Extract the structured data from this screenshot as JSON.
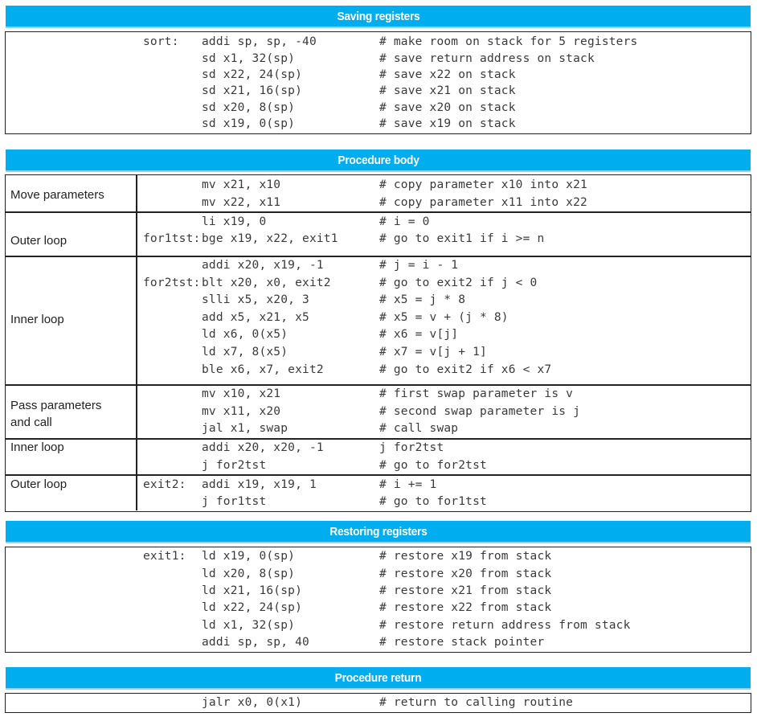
{
  "sections": {
    "saving": {
      "title": "Saving registers",
      "lines": [
        {
          "label": "sort:",
          "instr": "addi sp, sp, -40",
          "comment": "# make room on stack for 5 registers"
        },
        {
          "label": "",
          "instr": "sd x1, 32(sp)",
          "comment": "# save return address on stack"
        },
        {
          "label": "",
          "instr": "sd x22, 24(sp)",
          "comment": "# save x22 on stack"
        },
        {
          "label": "",
          "instr": "sd x21, 16(sp)",
          "comment": "# save x21 on stack"
        },
        {
          "label": "",
          "instr": "sd x20, 8(sp)",
          "comment": "# save x20 on stack"
        },
        {
          "label": "",
          "instr": "sd x19, 0(sp)",
          "comment": "# save x19 on stack"
        }
      ]
    },
    "body": {
      "title": "Procedure body",
      "groups": [
        {
          "name": "Move parameters",
          "lines": [
            {
              "label": "",
              "instr": "mv x21, x10",
              "comment": "# copy parameter x10 into x21"
            },
            {
              "label": "",
              "instr": "mv x22, x11",
              "comment": "# copy parameter x11 into x22"
            }
          ]
        },
        {
          "name": "Outer loop",
          "lines": [
            {
              "label": "",
              "instr": "li x19, 0",
              "comment": "# i = 0"
            },
            {
              "label": "for1tst:",
              "instr": "bge x19, x22, exit1",
              "comment": "# go to exit1 if i >= n"
            }
          ]
        },
        {
          "name": "Inner loop",
          "lines": [
            {
              "label": "",
              "instr": "addi x20, x19, -1",
              "comment": "# j = i - 1"
            },
            {
              "label": "for2tst:",
              "instr": "blt x20, x0, exit2",
              "comment": "# go to exit2 if j < 0"
            },
            {
              "label": "",
              "instr": "slli x5, x20, 3",
              "comment": "# x5 = j * 8"
            },
            {
              "label": "",
              "instr": "add x5, x21, x5",
              "comment": "# x5 = v + (j * 8)"
            },
            {
              "label": "",
              "instr": "ld x6, 0(x5)",
              "comment": "# x6 = v[j]"
            },
            {
              "label": "",
              "instr": "ld x7, 8(x5)",
              "comment": "# x7 = v[j + 1]"
            },
            {
              "label": "",
              "instr": "ble x6, x7, exit2",
              "comment": "# go to exit2 if x6 < x7"
            }
          ]
        },
        {
          "name": "Pass parameters and call",
          "name_line1": "Pass parameters",
          "name_line2": "and call",
          "lines": [
            {
              "label": "",
              "instr": "mv x10, x21",
              "comment": "# first swap parameter is v"
            },
            {
              "label": "",
              "instr": "mv x11, x20",
              "comment": "# second swap parameter is j"
            },
            {
              "label": "",
              "instr": "jal x1, swap",
              "comment": "# call swap"
            }
          ]
        },
        {
          "name": "Inner loop",
          "lines": [
            {
              "label": "",
              "instr": "addi x20, x20, -1",
              "comment": "j for2tst"
            },
            {
              "label": "",
              "instr": "j for2tst",
              "comment": "# go to for2tst"
            }
          ]
        },
        {
          "name": "Outer loop",
          "lines": [
            {
              "label": "exit2:",
              "instr": "addi x19, x19, 1",
              "comment": "# i += 1"
            },
            {
              "label": "",
              "instr": "j for1tst",
              "comment": "# go to for1tst"
            }
          ]
        }
      ]
    },
    "restoring": {
      "title": "Restoring registers",
      "lines": [
        {
          "label": "exit1:",
          "instr": "ld x19, 0(sp)",
          "comment": "# restore x19 from stack"
        },
        {
          "label": "",
          "instr": "ld x20, 8(sp)",
          "comment": "# restore x20 from stack"
        },
        {
          "label": "",
          "instr": "ld x21, 16(sp)",
          "comment": "# restore x21 from stack"
        },
        {
          "label": "",
          "instr": "ld x22, 24(sp)",
          "comment": "# restore x22 from stack"
        },
        {
          "label": "",
          "instr": "ld x1, 32(sp)",
          "comment": "# restore return address from stack"
        },
        {
          "label": "",
          "instr": "addi sp, sp, 40",
          "comment": "# restore stack pointer"
        }
      ]
    },
    "return": {
      "title": "Procedure return",
      "lines": [
        {
          "label": "",
          "instr": "jalr x0, 0(x1)",
          "comment": "# return to calling routine"
        }
      ]
    }
  },
  "colors": {
    "header_bg": "#00aeef",
    "header_text": "#ffffff",
    "code_text": "#3a3a3a",
    "border": "#222222"
  }
}
